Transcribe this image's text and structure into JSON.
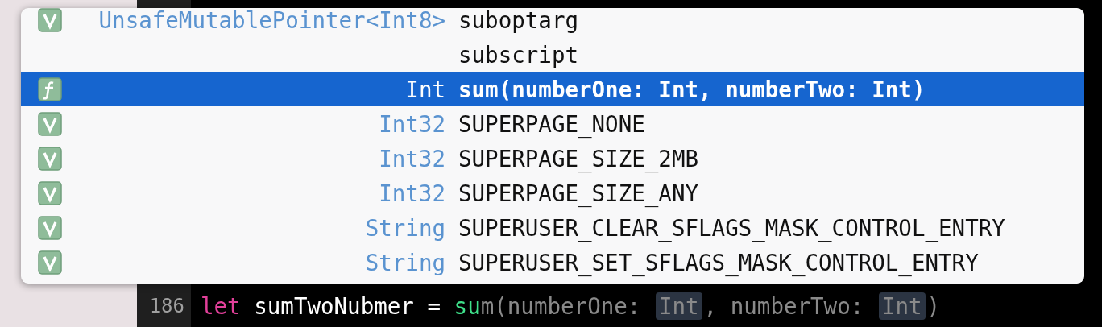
{
  "completions": [
    {
      "kind": "variable",
      "type": "UnsafeMutablePointer<Int8>",
      "name": "suboptarg",
      "selected": false
    },
    {
      "kind": "keyword",
      "name": "subscript",
      "selected": false
    },
    {
      "kind": "function",
      "type": "Int",
      "name": "sum(numberOne: Int, numberTwo: Int)",
      "selected": true
    },
    {
      "kind": "variable",
      "type": "Int32",
      "name": "SUPERPAGE_NONE",
      "selected": false
    },
    {
      "kind": "variable",
      "type": "Int32",
      "name": "SUPERPAGE_SIZE_2MB",
      "selected": false
    },
    {
      "kind": "variable",
      "type": "Int32",
      "name": "SUPERPAGE_SIZE_ANY",
      "selected": false
    },
    {
      "kind": "variable",
      "type": "String",
      "name": "SUPERUSER_CLEAR_SFLAGS_MASK_CONTROL_ENTRY",
      "selected": false
    },
    {
      "kind": "variable",
      "type": "String",
      "name": "SUPERUSER_SET_SFLAGS_MASK_CONTROL_ENTRY",
      "selected": false
    }
  ],
  "editor": {
    "line_number": "186",
    "tokens": [
      {
        "kind": "keyword",
        "text": "let"
      },
      {
        "kind": "plain",
        "text": " sumTwoNubmer = "
      },
      {
        "kind": "typed",
        "text": "su"
      },
      {
        "kind": "hint",
        "text": "m(numberOne: "
      },
      {
        "kind": "placeholder",
        "text": "Int"
      },
      {
        "kind": "hint",
        "text": ", numberTwo: "
      },
      {
        "kind": "placeholder",
        "text": "Int"
      },
      {
        "kind": "hint",
        "text": ")"
      }
    ]
  }
}
